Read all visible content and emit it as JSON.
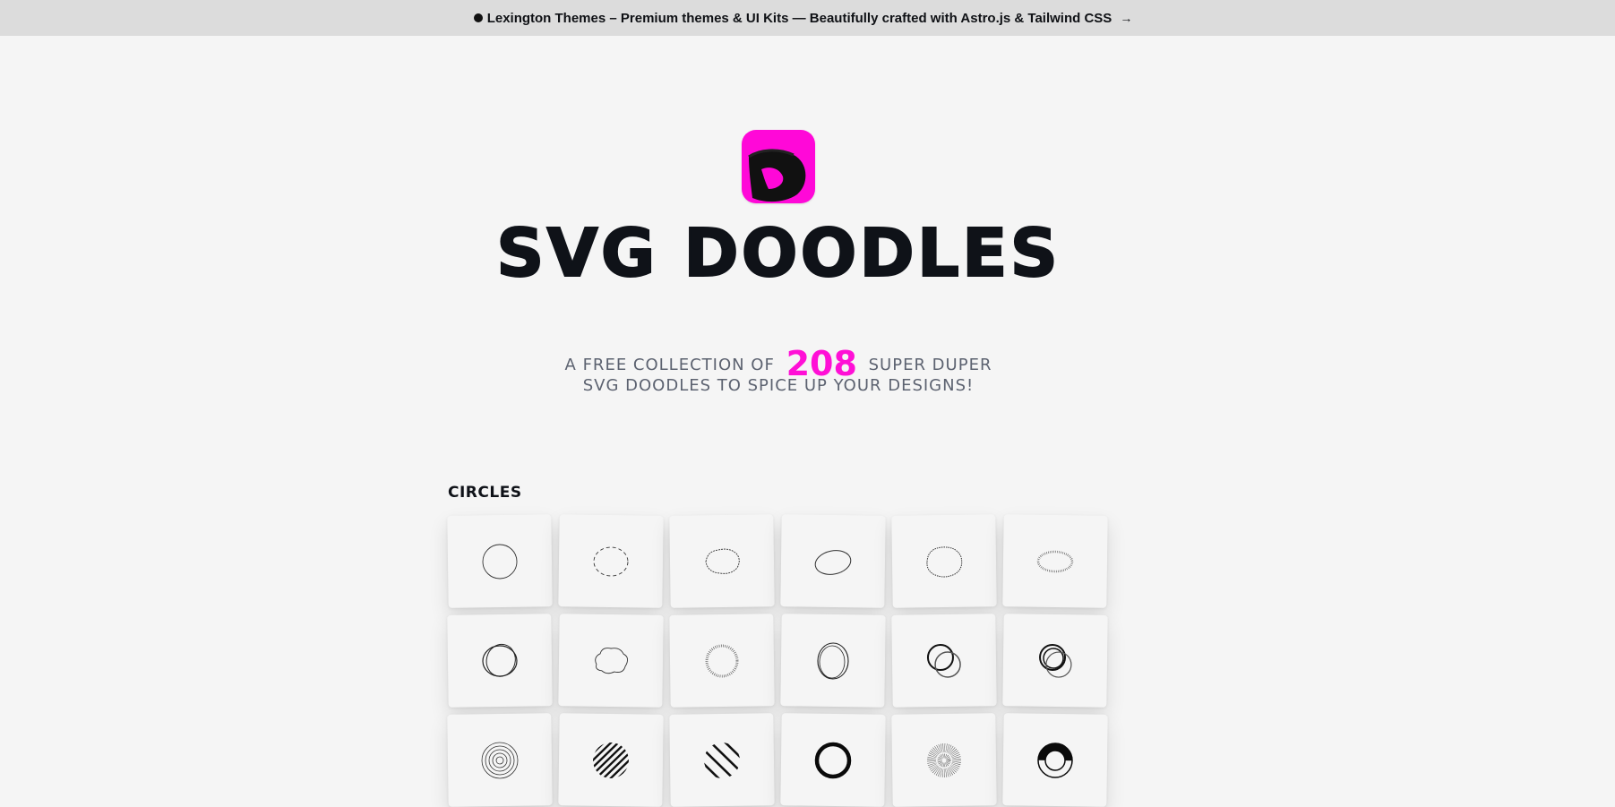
{
  "banner": {
    "text": "Lexington Themes – Premium themes & UI Kits — Beautifully crafted with Astro.js & Tailwind CSS",
    "arrow": "→"
  },
  "logo": {
    "letter": "D",
    "color": "#ff08d8"
  },
  "hero": {
    "title": "SVG DOODLES",
    "subtitle_before": "A FREE COLLECTION OF",
    "count": "208",
    "subtitle_after": "SUPER DUPER",
    "subtitle_line2": "SVG DOODLES TO SPICE UP YOUR DESIGNS!"
  },
  "section": {
    "label": "CIRCLES",
    "doodles": [
      "thin-circle",
      "dashed-circle",
      "scribble-fuzzy-circle",
      "tilted-oval",
      "wavy-fuzzy-circle",
      "hairy-oval",
      "double-loop-circle",
      "cloud-circle",
      "spiky-circle",
      "loop-oval",
      "overlapping-circles",
      "triple-overlap-circles",
      "concentric-rings",
      "hatched-disc",
      "striped-disc",
      "bold-ring",
      "dot-burst",
      "half-filled-ring"
    ]
  },
  "colors": {
    "accent": "#ff08d8",
    "banner_bg": "#dcdcdc",
    "page_bg": "#f5f5f5"
  }
}
